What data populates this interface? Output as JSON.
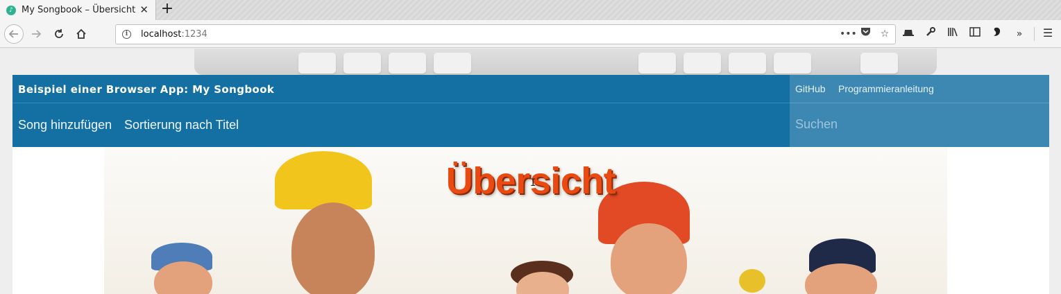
{
  "browser": {
    "tab_title": "My Songbook – Übersicht",
    "tab_close": "✕",
    "new_tab": "+",
    "url_host": "localhost",
    "url_port": ":1234",
    "icons": {
      "back": "back-arrow-icon",
      "forward": "forward-arrow-icon",
      "reload": "reload-icon",
      "home": "home-icon",
      "site_info": "info-icon",
      "page_actions": "more-dots-icon",
      "pocket": "pocket-icon",
      "bookmark": "star-icon",
      "toolbar": [
        "hat-icon",
        "wrench-icon",
        "library-icon",
        "sidebar-icon",
        "extension-icon",
        "overflow-icon"
      ],
      "menu": "hamburger-menu-icon"
    }
  },
  "app": {
    "brand": "Beispiel einer Browser App: My Songbook",
    "top_links": {
      "github": "GitHub",
      "guide": "Programmieranleitung"
    },
    "menu": {
      "add_song": "Song hinzufügen",
      "sort": "Sortierung nach Titel"
    },
    "search": {
      "placeholder": "Suchen",
      "value": ""
    },
    "page_title": "Übersicht"
  },
  "colors": {
    "nav_primary": "#1470a3",
    "nav_secondary": "#3d88b3",
    "title_orange": "#ea4a12"
  }
}
